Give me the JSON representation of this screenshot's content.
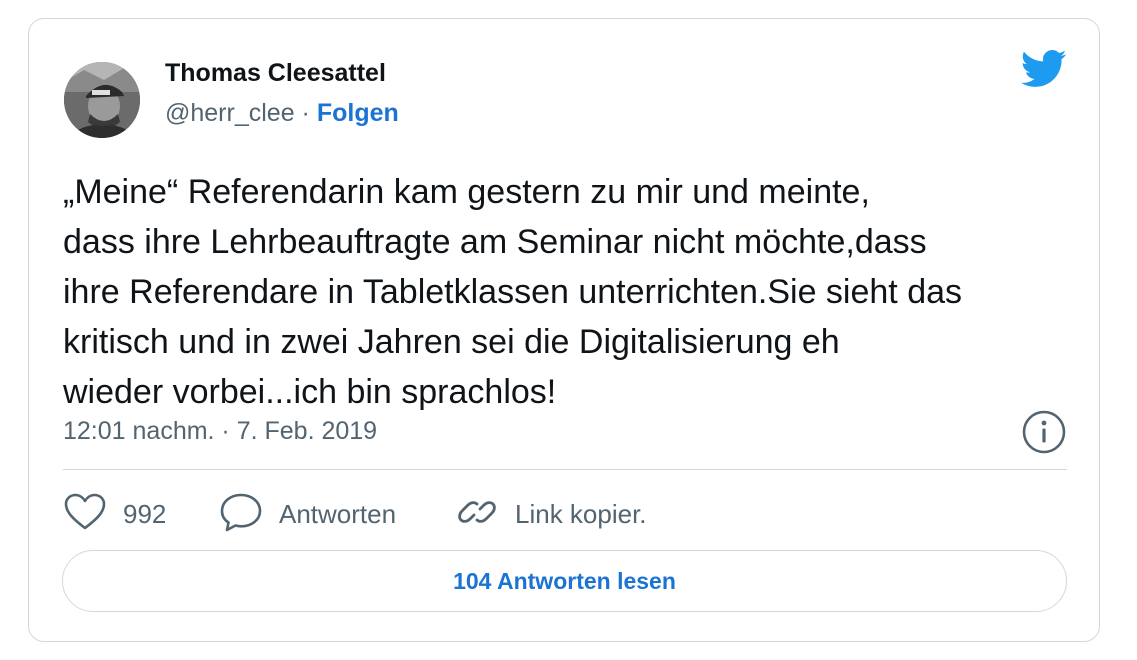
{
  "author": {
    "name": "Thomas Cleesattel",
    "handle": "@herr_clee",
    "separator": " · ",
    "follow_label": "Folgen"
  },
  "tweet": {
    "text": "„Meine“ Referendarin kam gestern zu mir und meinte,\ndass ihre Lehrbeauftragte am Seminar nicht möchte,dass\nihre Referendare in Tabletklassen unterrichten.Sie sieht das\nkritisch und in zwei Jahren sei die Digitalisierung eh\nwieder vorbei...ich bin sprachlos!",
    "timestamp": "12:01 nachm. · 7. Feb. 2019"
  },
  "actions": {
    "like_count": "992",
    "reply_label": "Antworten",
    "copy_link_label": "Link kopier."
  },
  "read_replies_label": "104 Antworten lesen",
  "icons": {
    "brand": "twitter-bird-icon",
    "info": "info-icon",
    "like": "heart-icon",
    "reply": "speech-bubble-icon",
    "copy": "link-icon"
  },
  "colors": {
    "brand_blue": "#1d9bf0",
    "link_blue": "#1b74d3",
    "text_primary": "#0f1419",
    "text_secondary": "#536471",
    "border": "#cfd9de"
  }
}
